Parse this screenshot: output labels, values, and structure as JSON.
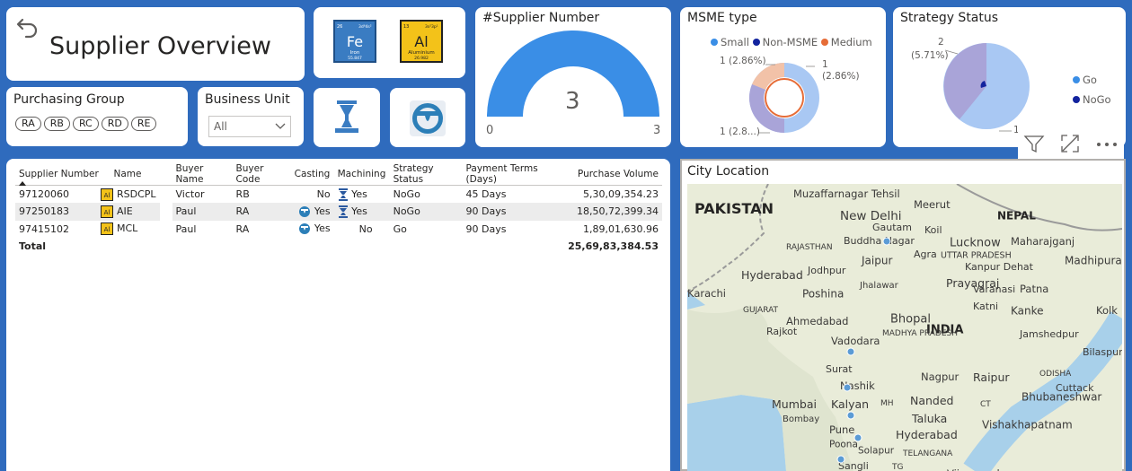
{
  "title_card": {
    "title": "Supplier Overview",
    "back_icon": "back-arrow-icon"
  },
  "purchasing_group": {
    "title": "Purchasing Group",
    "chips": [
      "RA",
      "RB",
      "RC",
      "RD",
      "RE"
    ]
  },
  "business_unit": {
    "title": "Business Unit",
    "selected": "All"
  },
  "material_tiles": [
    {
      "name": "iron-element-icon",
      "number": "26",
      "config": "3d⁶4s²",
      "symbol": "Fe",
      "element": "Iron",
      "mass": "55.847",
      "bg": "#3a7cc2"
    },
    {
      "name": "aluminium-element-icon",
      "number": "13",
      "config": "3s²3p¹",
      "symbol": "Al",
      "element": "Aluminium",
      "mass": "26.982",
      "bg": "#f3c219"
    }
  ],
  "process_tiles": [
    {
      "name": "machining-press-icon"
    },
    {
      "name": "casting-ladle-icon"
    }
  ],
  "gauge": {
    "title": "#Supplier Number",
    "value": "3",
    "min": "0",
    "max": "3",
    "fill_fraction": 1.0,
    "color": "#3a8ee6"
  },
  "msme": {
    "title": "MSME type",
    "legend": [
      {
        "label": "Small",
        "color": "#3a8ee6"
      },
      {
        "label": "Non-MSME",
        "color": "#12239e"
      },
      {
        "label": "Medium",
        "color": "#e66c37"
      }
    ],
    "labels": {
      "left_top": "1 (2.86%)",
      "right_top_count": "1",
      "right_top_pct": "(2.86%)",
      "bottom": "1 (2.8...)"
    }
  },
  "strategy": {
    "title": "Strategy Status",
    "legend": [
      {
        "label": "Go",
        "color": "#3a8ee6"
      },
      {
        "label": "NoGo",
        "color": "#12239e"
      }
    ],
    "labels": {
      "top_count": "2",
      "top_pct": "(5.71%)",
      "bottom": "1"
    }
  },
  "table": {
    "headers": [
      "Supplier Number",
      "Name",
      "Buyer Name",
      "Buyer Code",
      "Casting",
      "Machining",
      "Strategy Status",
      "Payment Terms (Days)",
      "Purchase Volume"
    ],
    "rows": [
      {
        "supplier": "97120060",
        "name": "RSDCPL",
        "buyer": "Victor",
        "code": "RB",
        "casting": "No",
        "casting_icon": false,
        "machining": "Yes",
        "machining_icon": true,
        "strategy": "NoGo",
        "terms": "45 Days",
        "volume": "5,30,09,354.23"
      },
      {
        "supplier": "97250183",
        "name": "AIE",
        "buyer": "Paul",
        "code": "RA",
        "casting": "Yes",
        "casting_icon": true,
        "machining": "Yes",
        "machining_icon": true,
        "strategy": "NoGo",
        "terms": "90 Days",
        "volume": "18,50,72,399.34"
      },
      {
        "supplier": "97415102",
        "name": "MCL",
        "buyer": "Paul",
        "code": "RA",
        "casting": "Yes",
        "casting_icon": true,
        "machining": "No",
        "machining_icon": false,
        "strategy": "Go",
        "terms": "90 Days",
        "volume": "1,89,01,630.96"
      }
    ],
    "total_label": "Total",
    "total_volume": "25,69,83,384.53"
  },
  "map": {
    "title": "City Location",
    "places": [
      {
        "text": "PAKISTAN",
        "big": true
      },
      {
        "text": "Muzaffarnagar Tehsil"
      },
      {
        "text": "Meerut"
      },
      {
        "text": "NEPAL",
        "big": true
      },
      {
        "text": "New Delhi"
      },
      {
        "text": "Gautam"
      },
      {
        "text": "Koil"
      },
      {
        "text": "Lucknow"
      },
      {
        "text": "Maharajganj"
      },
      {
        "text": "Buddha Nagar"
      },
      {
        "text": "RAJASTHAN"
      },
      {
        "text": "Jaipur"
      },
      {
        "text": "Agra"
      },
      {
        "text": "UTTAR PRADESH"
      },
      {
        "text": "Kanpur Dehat"
      },
      {
        "text": "Madhipura"
      },
      {
        "text": "Hyderabad"
      },
      {
        "text": "Jodhpur"
      },
      {
        "text": "Prayagraj"
      },
      {
        "text": "Jhalawar"
      },
      {
        "text": "Varanasi"
      },
      {
        "text": "Patna"
      },
      {
        "text": "Karachi"
      },
      {
        "text": "Poshina"
      },
      {
        "text": "GUJARAT"
      },
      {
        "text": "Bhopal"
      },
      {
        "text": "Katni"
      },
      {
        "text": "Kanke"
      },
      {
        "text": "Kolk"
      },
      {
        "text": "Ahmedabad"
      },
      {
        "text": "INDIA",
        "big": true
      },
      {
        "text": "Rajkot"
      },
      {
        "text": "Vadodara"
      },
      {
        "text": "MADHYA PRADESH"
      },
      {
        "text": "Jamshedpur"
      },
      {
        "text": "Bilaspur"
      },
      {
        "text": "Surat"
      },
      {
        "text": "Nagpur"
      },
      {
        "text": "Raipur"
      },
      {
        "text": "ODISHA"
      },
      {
        "text": "Nashik"
      },
      {
        "text": "Cuttack"
      },
      {
        "text": "Mumbai"
      },
      {
        "text": "Kalyan"
      },
      {
        "text": "MH"
      },
      {
        "text": "Nanded"
      },
      {
        "text": "CT"
      },
      {
        "text": "Bhubaneshwar"
      },
      {
        "text": "Bombay"
      },
      {
        "text": "Taluka"
      },
      {
        "text": "Pune"
      },
      {
        "text": "Vishakhapatnam"
      },
      {
        "text": "Poona"
      },
      {
        "text": "Hyderabad"
      },
      {
        "text": "Solapur"
      },
      {
        "text": "TELANGANA"
      },
      {
        "text": "TG"
      },
      {
        "text": "Sangli"
      },
      {
        "text": "Vijayawada"
      }
    ]
  },
  "visual_header_icons": [
    "filter-icon",
    "focus-mode-icon",
    "more-options-icon"
  ],
  "colors": {
    "background": "#2f6bbd",
    "accent": "#3a8ee6",
    "dark_blue": "#12239e",
    "orange": "#e66c37",
    "lavender": "#a9a4d8"
  }
}
